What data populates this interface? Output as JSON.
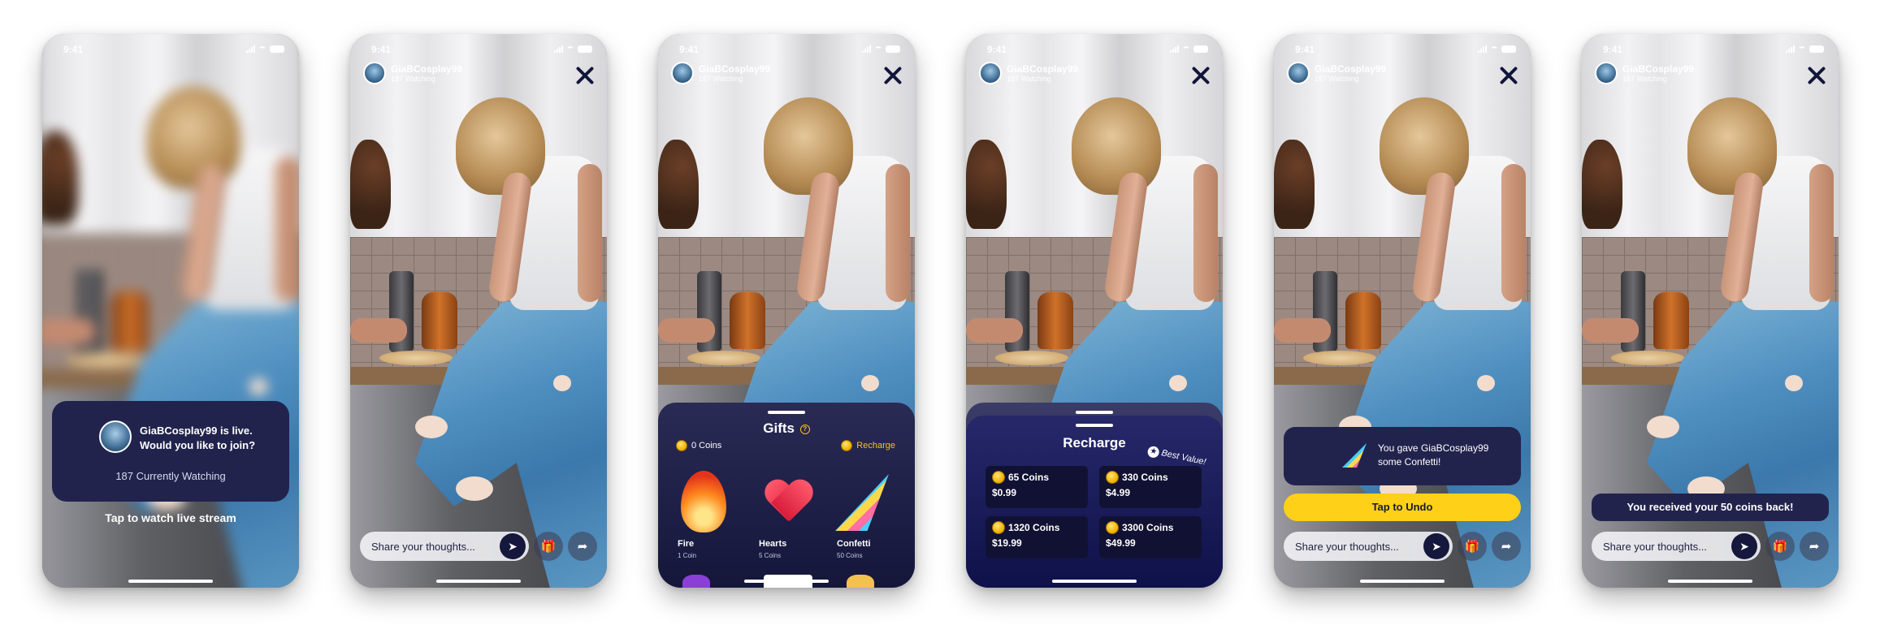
{
  "status_time": "9:41",
  "streamer": {
    "name": "GiaBCosplay99",
    "watching": "187 Watching"
  },
  "screen1": {
    "join_line1": "GiaBCosplay99 is live.",
    "join_line2": "Would you like to join?",
    "currently_watching": "187 Currently Watching",
    "tap_label": "Tap to watch live stream"
  },
  "chat": {
    "placeholder": "Share your thoughts..."
  },
  "gifts": {
    "title": "Gifts",
    "coins": "0 Coins",
    "recharge_label": "Recharge",
    "items": [
      {
        "label": "Fire",
        "price": "1 Coin"
      },
      {
        "label": "Hearts",
        "price": "5 Coins"
      },
      {
        "label": "Confetti",
        "price": "50 Coins"
      }
    ]
  },
  "recharge": {
    "title": "Recharge",
    "best_value": "Best Value!",
    "packs": [
      {
        "coins": "65 Coins",
        "price": "$0.99"
      },
      {
        "coins": "330 Coins",
        "price": "$4.99"
      },
      {
        "coins": "1320 Coins",
        "price": "$19.99"
      },
      {
        "coins": "3300 Coins",
        "price": "$49.99"
      }
    ]
  },
  "toast": {
    "gave_line1": "You gave GiaBCosplay99",
    "gave_line2": "some Confetti!",
    "undo_label": "Tap to Undo",
    "refund": "You received your 50 coins back!"
  },
  "colors": {
    "navy": "#15173c",
    "card": "#22234d",
    "accent_yellow": "#ffd018"
  }
}
